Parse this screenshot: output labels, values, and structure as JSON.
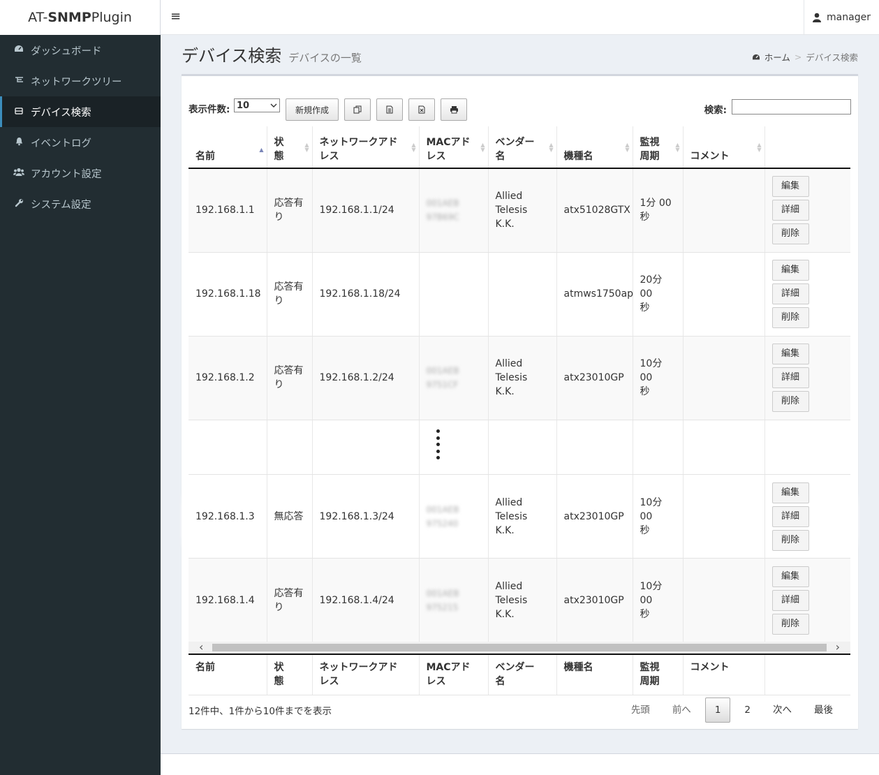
{
  "brand": {
    "prefix": "AT-",
    "bold": "SNMP",
    "suffix": " Plugin"
  },
  "topbar": {
    "user": "manager"
  },
  "sidebar": {
    "items": [
      {
        "label": "ダッシュボード",
        "icon": "dashboard-icon"
      },
      {
        "label": "ネットワークツリー",
        "icon": "network-icon"
      },
      {
        "label": "デバイス検索",
        "icon": "device-icon",
        "active": true
      },
      {
        "label": "イベントログ",
        "icon": "bell-icon"
      },
      {
        "label": "アカウント設定",
        "icon": "users-icon"
      },
      {
        "label": "システム設定",
        "icon": "wrench-icon"
      }
    ]
  },
  "header": {
    "title": "デバイス検索",
    "subtitle": "デバイスの一覧"
  },
  "breadcrumb": {
    "home": "ホーム",
    "sep": ">",
    "current": "デバイス検索"
  },
  "controls": {
    "length_label": "表示件数:",
    "length_value": "10",
    "new_button": "新規作成",
    "search_label": "検索:"
  },
  "table": {
    "headers": [
      "名前",
      "状態",
      "ネットワークアドレス",
      "MACアドレス",
      "ベンダー名",
      "機種名",
      "監視周期",
      "コメント",
      ""
    ],
    "header_lines": [
      [
        "名前"
      ],
      [
        "状",
        "態"
      ],
      [
        "ネットワークアド",
        "レス"
      ],
      [
        "MACアド",
        "レス"
      ],
      [
        "ベンダー",
        "名"
      ],
      [
        "機種名"
      ],
      [
        "監視",
        "周期"
      ],
      [
        "コメント"
      ],
      [
        ""
      ]
    ],
    "rows": [
      {
        "name": "192.168.1.1",
        "status": [
          "応答有",
          "り"
        ],
        "network": "192.168.1.1/24",
        "mac": [
          "001AEB",
          "97B69C"
        ],
        "vendor": [
          "Allied",
          "Telesis K.K."
        ],
        "model": "atx51028GTX",
        "period": [
          "1分 00",
          "秒"
        ],
        "comment": ""
      },
      {
        "name": "192.168.1.18",
        "status": [
          "応答有",
          "り"
        ],
        "network": "192.168.1.18/24",
        "mac": [
          "",
          ""
        ],
        "vendor": [
          "",
          ""
        ],
        "model": "atmws1750ap",
        "period": [
          "20分 00",
          "秒"
        ],
        "comment": ""
      },
      {
        "name": "192.168.1.2",
        "status": [
          "応答有",
          "り"
        ],
        "network": "192.168.1.2/24",
        "mac": [
          "001AEB",
          "9751CF"
        ],
        "vendor": [
          "Allied",
          "Telesis K.K."
        ],
        "model": "atx23010GP",
        "period": [
          "10分 00",
          "秒"
        ],
        "comment": ""
      },
      {
        "name": "192.168.1.3",
        "status": [
          "無応答",
          ""
        ],
        "network": "192.168.1.3/24",
        "mac": [
          "001AEB",
          "975240"
        ],
        "vendor": [
          "Allied",
          "Telesis K.K."
        ],
        "model": "atx23010GP",
        "period": [
          "10分 00",
          "秒"
        ],
        "comment": ""
      },
      {
        "name": "192.168.1.4",
        "status": [
          "応答有",
          "り"
        ],
        "network": "192.168.1.4/24",
        "mac": [
          "001AEB",
          "975215"
        ],
        "vendor": [
          "Allied",
          "Telesis K.K."
        ],
        "model": "atx23010GP",
        "period": [
          "10分 00",
          "秒"
        ],
        "comment": ""
      }
    ],
    "actions": {
      "edit": "編集",
      "detail": "詳細",
      "delete": "削除"
    }
  },
  "footer_info": "12件中、1件から10件までを表示",
  "pagination": {
    "first": "先頭",
    "prev": "前へ",
    "pages": [
      "1",
      "2"
    ],
    "current": "1",
    "next": "次へ",
    "last": "最後"
  },
  "colors": {
    "sidebar_bg": "#222d32",
    "content_bg": "#ecf0f5",
    "accent": "#3c8dbc"
  }
}
